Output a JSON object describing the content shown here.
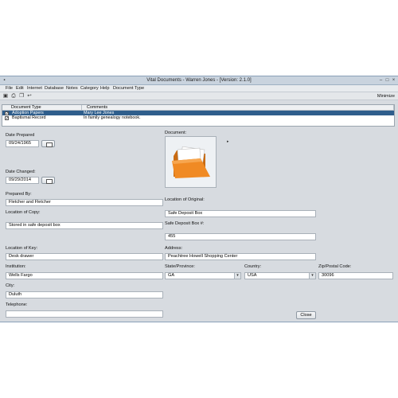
{
  "window": {
    "title": "Vital Documents - Warren Jones - [Version: 2.1.0]",
    "minimize_label": "Minimize"
  },
  "menu": [
    "File",
    "Edit",
    "Internet",
    "Database",
    "Notes",
    "Category",
    "Help",
    "Document Type"
  ],
  "toolbar": {
    "icons": [
      "save-icon",
      "print-icon",
      "copy-icon",
      "undo-icon"
    ]
  },
  "table": {
    "headers": [
      "Document Type",
      "Comments"
    ],
    "rows": [
      {
        "checked": true,
        "type": "Adoption Papers",
        "comment": "Mary Lee Jones",
        "selected": true
      },
      {
        "checked": true,
        "type": "Baptismal Record",
        "comment": "In family genealogy notebook.",
        "selected": false
      }
    ]
  },
  "form": {
    "date_prepared_label": "Date Prepared",
    "date_prepared": "09/24/1965",
    "date_changed_label": "Date Changed:",
    "date_changed": "09/29/2014",
    "document_label": "Document:",
    "prepared_by_label": "Prepared By:",
    "prepared_by": "Fletcher and Fletcher",
    "location_original_label": "Location of Original:",
    "location_original": "Safe Deposit Box",
    "location_copy_label": "Location of Copy:",
    "location_copy": "Stored in safe deposit box",
    "safe_box_label": "Safe Deposit Box #:",
    "safe_box": "455",
    "location_key_label": "Location of Key:",
    "location_key": "Desk drawer",
    "address_label": "Address:",
    "address": "Peachtree Howell Shopping Center",
    "institution_label": "Institution:",
    "institution": "Wells Fargo",
    "state_label": "State/Province:",
    "state": "GA",
    "country_label": "Country:",
    "country": "USA",
    "zip_label": "Zip/Postal Code:",
    "zip": "30096",
    "city_label": "City:",
    "city": "Duluth",
    "telephone_label": "Telephone:",
    "telephone": ""
  },
  "buttons": {
    "close": "Close"
  },
  "colors": {
    "selected_row": "#2f5e8c",
    "folder": "#f08a24"
  }
}
